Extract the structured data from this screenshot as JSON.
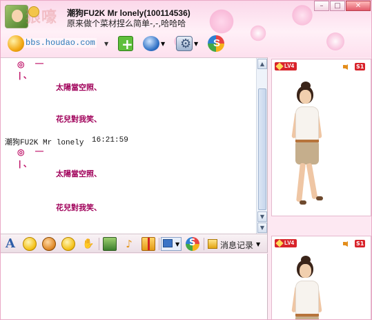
{
  "header": {
    "contact_title": "潮狗FU2K  Mr lonely(100114536)",
    "signature": "原来做个菜材捏么简单-,-,哈哈哈",
    "watermark": "狼嚎"
  },
  "window_buttons": {
    "minimize": "–",
    "maximize": "□",
    "close": "✕"
  },
  "toolbar": {
    "website_url": "bbs.houdao.com",
    "icons": [
      "globe-icon",
      "add-contact-icon",
      "vip-icon",
      "settings-icon",
      "soso-icon"
    ]
  },
  "chat": {
    "messages": [
      {
        "type": "art",
        "line1_sym": "◎",
        "line1_dash": "—",
        "line2": "| 、",
        "text1": "太陽當空照、",
        "text2": "花兒對我笑、"
      },
      {
        "type": "header",
        "sender": "潮狗FU2K  Mr lonely",
        "time": "16:21:59"
      },
      {
        "type": "art",
        "line1_sym": "◎",
        "line1_dash": "—",
        "line2": "| 、",
        "text1": "太陽當空照、",
        "text2": "花兒對我笑、"
      }
    ]
  },
  "input_toolbar": {
    "font_label": "A",
    "history_label": "消息记录",
    "icons": [
      "font-icon",
      "emoji-icon",
      "magic-emoji-icon",
      "shake-icon",
      "gift-hand-icon",
      "image-icon",
      "music-icon",
      "gift-box-icon",
      "screenshot-icon",
      "soso-icon",
      "history-icon"
    ]
  },
  "remote_panel": {
    "level": "LV4",
    "badge": "S1"
  },
  "self_panel": {
    "level": "LV4",
    "badge": "S1"
  },
  "colors": {
    "accent_pink": "#c0196c",
    "chrome_pink": "#fde8f2",
    "level_red": "#d8232a"
  }
}
